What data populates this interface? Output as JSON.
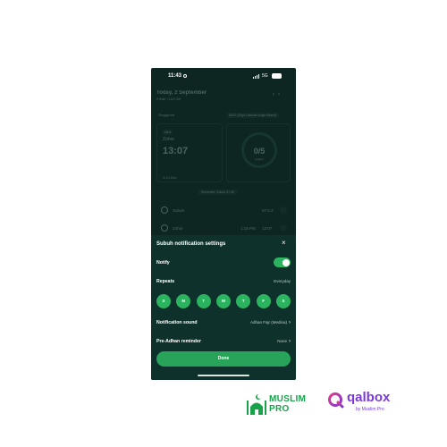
{
  "status_bar": {
    "time": "11:43",
    "network": "5G"
  },
  "background": {
    "date": "Today, 2 September",
    "hijri": "9 Rabi' I 1447 AH",
    "location": "Singapore",
    "method": "MUIS (High Latitude Angle Based)",
    "next_label": "Next",
    "next_prayer_name": "Zohor",
    "next_prayer_time": "13:07",
    "card_footer": "in 1h 24m",
    "prayers_done": "0/5",
    "prayers_done_label": "prayed",
    "pill": "Reminder: Subuh 07:45",
    "rows": [
      {
        "name": "Subuh",
        "t1": "",
        "t2": "07:5.2"
      },
      {
        "name": "Zohor",
        "t1": "1:15 PM",
        "t2": "13:07"
      }
    ]
  },
  "sheet": {
    "title": "Subuh notification settings",
    "notify_label": "Notify",
    "notify_on": true,
    "repeats_label": "Repeats",
    "repeats_value": "Everyday",
    "days": [
      "S",
      "M",
      "T",
      "W",
      "T",
      "F",
      "S"
    ],
    "sound_label": "Notification sound",
    "sound_value": "Adhan Fajr (Medina)",
    "reminder_label": "Pre-Adhan reminder",
    "reminder_value": "None",
    "done_label": "Done"
  },
  "logos": {
    "muslimpro_line1": "MUSLIM",
    "muslimpro_line2": "PRO",
    "qalbox_name": "qalbox",
    "qalbox_by": "by Muslim Pro"
  },
  "colors": {
    "accent": "#2bb35f",
    "sheet_bg": "#0f312b",
    "screen_bg": "#0d2622",
    "muslimpro_green": "#17a34a",
    "qalbox_purple": "#7a3ad8"
  }
}
